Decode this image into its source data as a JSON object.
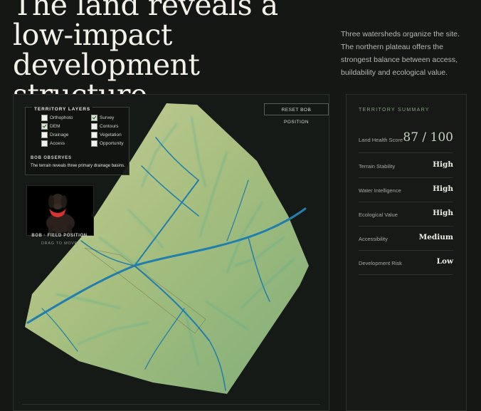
{
  "headline": "The land reveals a low-impact development structure.",
  "intro": "Three watersheds organize the site. The northern plateau offers the strongest balance between access, buildability and ecological value.",
  "map": {
    "reset_button": "RESET BOB POSITION",
    "layers_title": "TERRITORY LAYERS",
    "layers": [
      {
        "label": "Orthophoto",
        "checked": false
      },
      {
        "label": "Survey",
        "checked": true
      },
      {
        "label": "DEM",
        "checked": true
      },
      {
        "label": "Contours",
        "checked": false
      },
      {
        "label": "Drainage",
        "checked": false
      },
      {
        "label": "Vegetation",
        "checked": false
      },
      {
        "label": "Access",
        "checked": false
      },
      {
        "label": "Opportunity",
        "checked": false
      }
    ],
    "observation_title": "BOB OBSERVES",
    "observation_text": "The terrain reveals three primary drainage basins.",
    "dog_caption": "BOB · FIELD POSITION",
    "dog_hint": "DRAG TO MOVE",
    "colors": {
      "terrain": "#9fb77a",
      "drainage": "#1f7fae",
      "flow": "#3fb7a8"
    }
  },
  "summary": {
    "title": "TERRITORY SUMMARY",
    "score_label": "Land Health Score",
    "score_value": "87 / 100",
    "metrics": [
      {
        "label": "Terrain Stability",
        "value": "High"
      },
      {
        "label": "Water Intelligence",
        "value": "High"
      },
      {
        "label": "Ecological Value",
        "value": "High"
      },
      {
        "label": "Accessibility",
        "value": "Medium"
      },
      {
        "label": "Development Risk",
        "value": "Low"
      }
    ]
  }
}
